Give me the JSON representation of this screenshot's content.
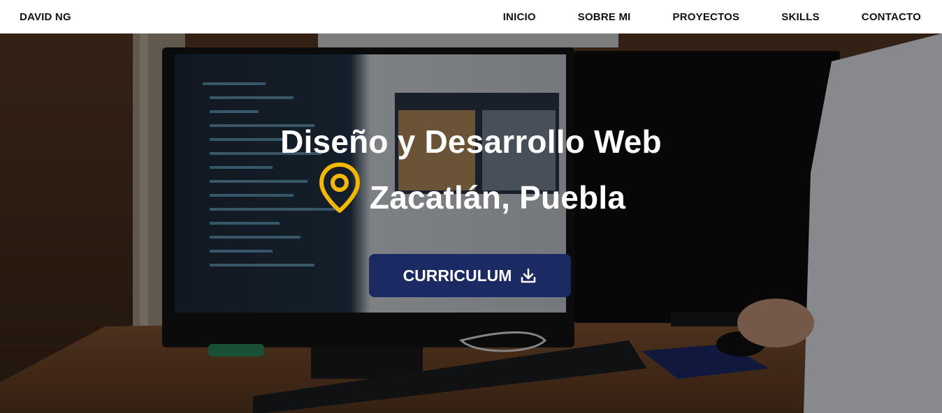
{
  "header": {
    "brand": "DAVID NG",
    "nav": [
      "INICIO",
      "SOBRE MI",
      "PROYECTOS",
      "SKILLS",
      "CONTACTO"
    ]
  },
  "hero": {
    "title": "Diseño y Desarrollo Web",
    "location": "Zacatlán, Puebla",
    "location_icon": "map-pin-icon",
    "cta_label": "CURRICULUM",
    "cta_icon": "download-icon"
  },
  "colors": {
    "accent_pin": "#f5b800",
    "button_bg": "#1b2a63",
    "nav_text": "#111111"
  }
}
